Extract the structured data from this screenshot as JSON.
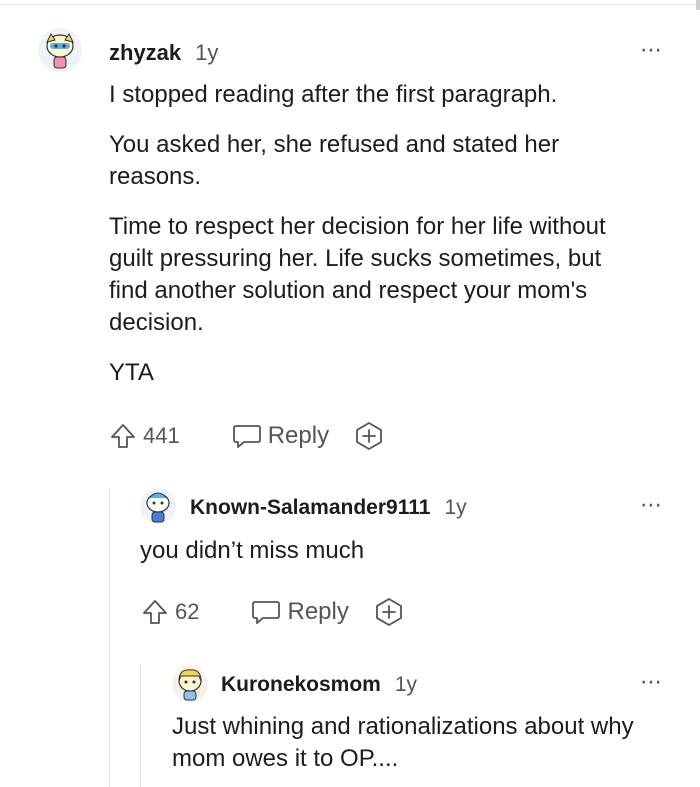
{
  "comments": [
    {
      "username": "zhyzak",
      "time": "1y",
      "paragraphs": [
        "I stopped reading after the first paragraph.",
        "You asked her, she refused and stated her reasons.",
        "Time to respect her decision for her life without guilt pressuring her. Life sucks sometimes, but find another solution and respect your mom's decision.",
        "YTA"
      ],
      "votes": "441",
      "reply_label": "Reply",
      "more_icon": "⋯"
    },
    {
      "username": "Known-Salamander9111",
      "time": "1y",
      "paragraphs": [
        "you didn’t miss much"
      ],
      "votes": "62",
      "reply_label": "Reply",
      "more_icon": "⋯"
    },
    {
      "username": "Kuronekosmom",
      "time": "1y",
      "paragraphs": [
        "Just whining and rationalizations about why mom owes it to OP...."
      ],
      "more_icon": "⋯"
    }
  ],
  "colors": {
    "text": "#1c1c1c",
    "muted": "#555555",
    "thread_line": "#e0e0e0"
  }
}
